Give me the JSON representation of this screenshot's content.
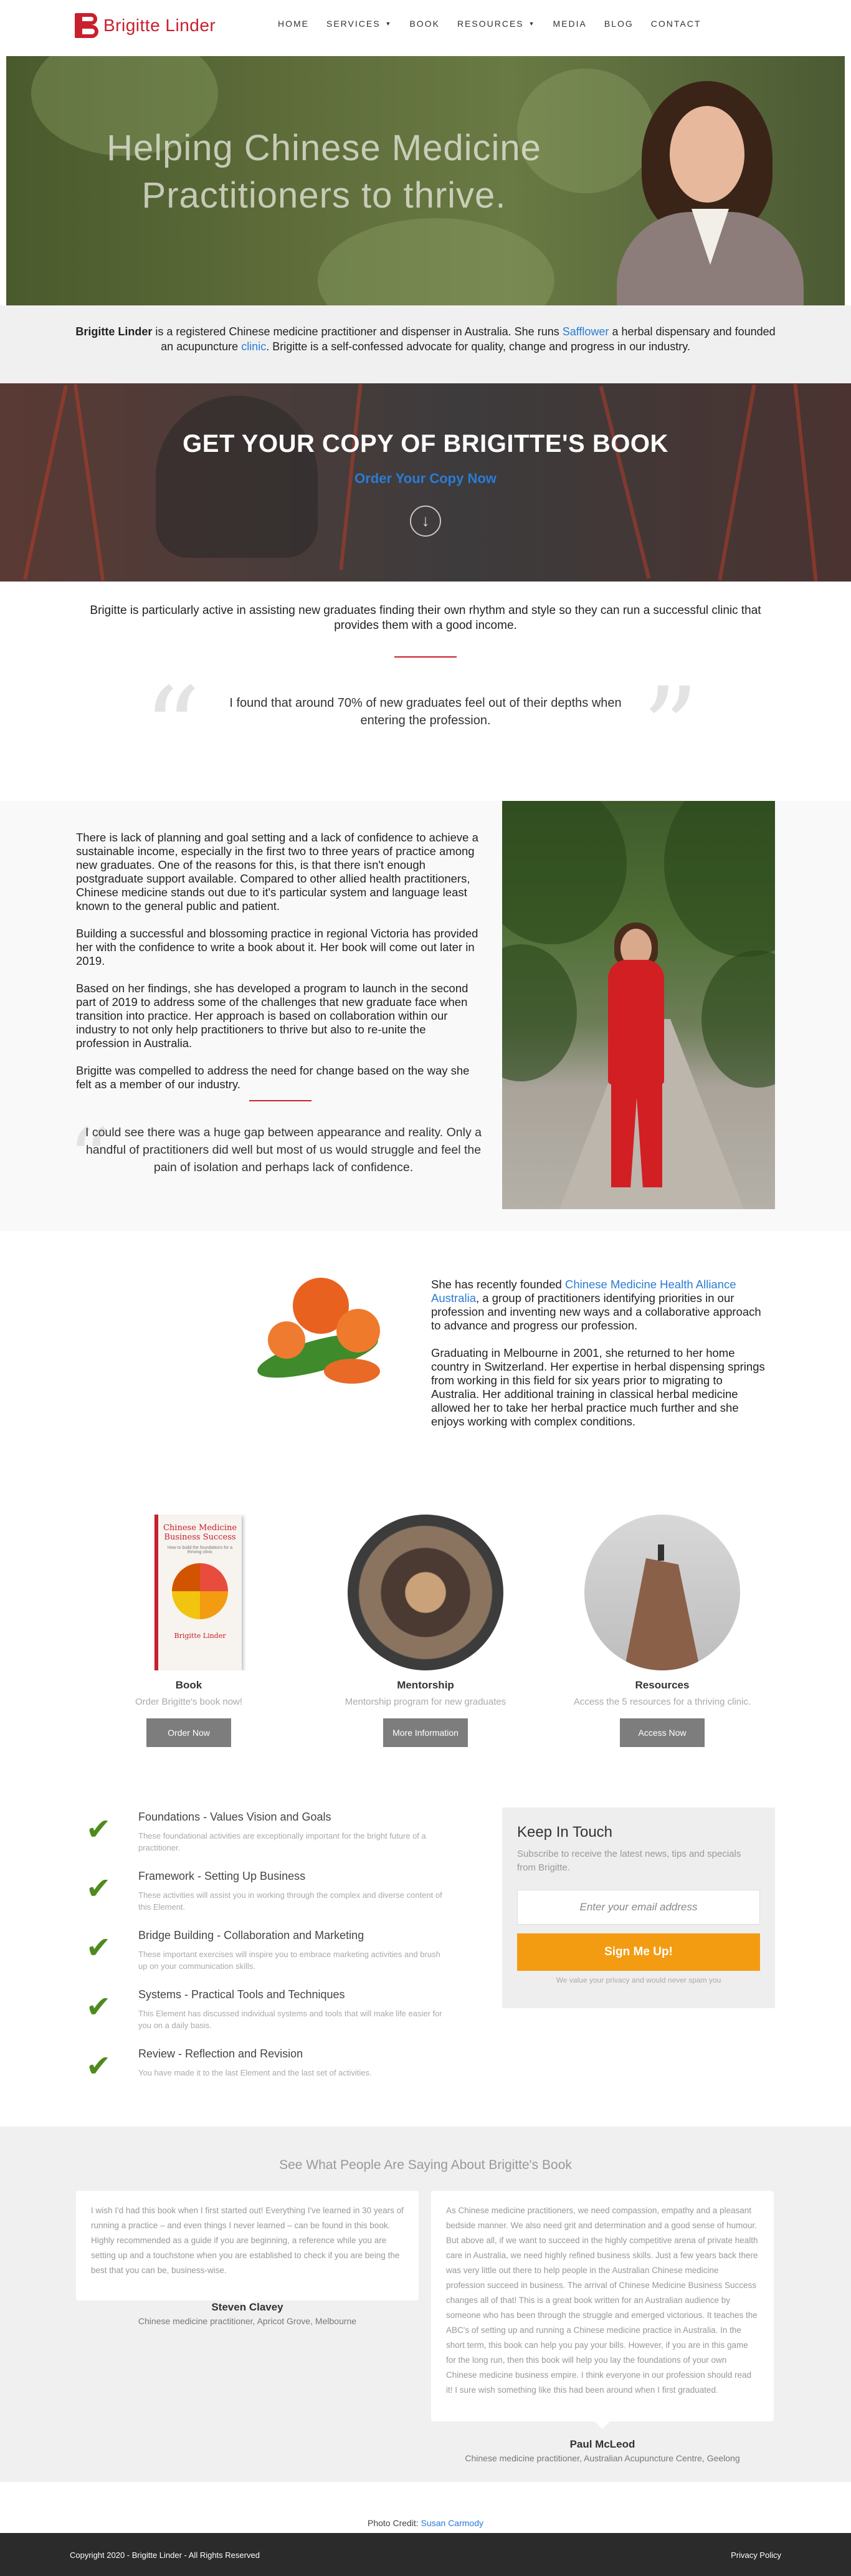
{
  "nav": {
    "logo_text": "Brigitte Linder",
    "items": [
      {
        "label": "HOME",
        "dropdown": false
      },
      {
        "label": "SERVICES",
        "dropdown": true
      },
      {
        "label": "BOOK",
        "dropdown": false
      },
      {
        "label": "RESOURCES",
        "dropdown": true
      },
      {
        "label": "MEDIA",
        "dropdown": false
      },
      {
        "label": "BLOG",
        "dropdown": false
      },
      {
        "label": "CONTACT",
        "dropdown": false
      }
    ]
  },
  "hero": {
    "title": "Helping Chinese Medicine Practitioners to thrive."
  },
  "intro": {
    "name": "Brigitte Linder",
    "text1": " is a registered Chinese medicine practitioner and dispenser in Australia. She runs ",
    "link1": "Safflower",
    "text2": " a herbal dispensary and founded an acupuncture ",
    "link2": "clinic",
    "text3": ". Brigitte is a self-confessed advocate for quality, change and progress in our industry."
  },
  "book_banner": {
    "title": "GET YOUR COPY OF BRIGITTE'S BOOK",
    "link": "Order Your Copy Now",
    "down_icon": "arrow-down-circle-icon"
  },
  "active_text": "Brigitte is particularly active in assisting new graduates finding their own rhythm and style so they can run a successful clinic that provides them with a good income.",
  "quote1": "I found that around 70% of new graduates feel out of their depths when entering the profession.",
  "story": {
    "paragraphs": [
      "There is lack of planning and goal setting and a lack of confidence to achieve a sustainable income, especially in the first two to three years of practice among new graduates. One of the reasons for this, is that there isn't enough postgraduate support available. Compared to other allied health practitioners, Chinese medicine stands out due to it's particular system and language least known to the general public and patient.",
      "Building a successful and blossoming practice in regional Victoria has provided her with the confidence to write a book about it. Her book will come out later in 2019.",
      "Based on her findings, she has developed a program to launch in the second part of 2019 to address some of the challenges that new graduate face when transition into practice. Her approach is based on collaboration within our industry to not only help practitioners to thrive but also to re-unite the profession in Australia.",
      "Brigitte was compelled to address the need for change based on the way she felt as a member of our industry."
    ],
    "quote": "I could see there was a huge gap between appearance and reality. Only a handful of practitioners did well but most of us would struggle and feel the pain of isolation and perhaps lack of confidence."
  },
  "founded": {
    "p1_before": "She has recently founded ",
    "p1_link": "Chinese Medicine Health Alliance Australia",
    "p1_after": ", a group of practitioners identifying priorities in our profession and inventing new ways and a collaborative approach to advance and progress our profession.",
    "p2": "Graduating in Melbourne in 2001, she returned to her home country in Switzerland. Her expertise in herbal dispensing springs from working in this field for six years prior to migrating to Australia. Her additional training in classical herbal medicine allowed her to take her herbal practice much further and she enjoys working with complex conditions."
  },
  "cards": [
    {
      "title": "Book",
      "sub": "Order Brigitte's book now!",
      "button": "Order Now",
      "book_title": "Chinese Medicine Business Success",
      "book_sub": "How to build the foundations for a thriving clinic",
      "book_author": "Brigitte Linder"
    },
    {
      "title": "Mentorship",
      "sub": "Mentorship program for new graduates",
      "button": "More Information"
    },
    {
      "title": "Resources",
      "sub": "Access the 5 resources for a thriving clinic.",
      "button": "Access Now"
    }
  ],
  "steps": [
    {
      "title": "Foundations - Values Vision and Goals",
      "desc": "These foundational activities are exceptionally important for the bright future of a practitioner.",
      "icon": "checkmark-icon"
    },
    {
      "title": "Framework - Setting Up Business",
      "desc": "These activities will assist you in working through the complex and diverse content of this Element.",
      "icon": "checkmark-icon"
    },
    {
      "title": "Bridge Building - Collaboration and Marketing",
      "desc": "These important exercises will inspire you to embrace marketing activities and brush up on your communication skills.",
      "icon": "checkmark-icon"
    },
    {
      "title": "Systems - Practical Tools and Techniques",
      "desc": "This Element has discussed individual systems and tools that will make life easier for you on a daily basis.",
      "icon": "checkmark-icon"
    },
    {
      "title": "Review - Reflection and Revision",
      "desc": "You have made it to the last Element and the last set of activities.",
      "icon": "checkmark-icon"
    }
  ],
  "keep_in_touch": {
    "title": "Keep In Touch",
    "lead": "Subscribe to receive the latest news, tips and specials from Brigitte.",
    "email_placeholder": "Enter your email address",
    "button": "Sign Me Up!",
    "privacy": "We value your privacy and would never spam you"
  },
  "testimonials": {
    "heading": "See What People Are Saying About Brigitte's Book",
    "items": [
      {
        "text": "I wish I'd had this book when I first started out! Everything I've learned in 30 years of running a practice – and even things I never learned – can be found in this book. Highly recommended as a guide if you are beginning, a reference while you are setting up and a touchstone when you are established to check if you are being the best that you can be, business-wise.",
        "name": "Steven Clavey",
        "role": "Chinese medicine practitioner, Apricot Grove, Melbourne"
      },
      {
        "text": "As Chinese medicine practitioners, we need compassion, empathy and a pleasant bedside manner. We also need grit and determination and a good sense of humour. But above all, if we want to succeed in the highly competitive arena of private health care in Australia, we need highly refined business skills. Just a few years back there was very little out there to help people in the Australian Chinese medicine profession succeed in business. The arrival of Chinese Medicine Business Success changes all of that! This is a great book written for an Australian audience by someone who has been through the struggle and emerged victorious. It teaches the ABC's of setting up and running a Chinese medicine practice in Australia. In the short term, this book can help you pay your bills. However, if you are in this game for the long run, then this book will help you lay the foundations of your own Chinese medicine business empire. I think everyone in our profession should read it! I sure wish something like this had been around when I first graduated.",
        "name": "Paul McLeod",
        "role": "Chinese medicine practitioner, Australian Acupuncture Centre, Geelong"
      }
    ]
  },
  "credit": {
    "label": "Photo Credit: ",
    "name": "Susan Carmody"
  },
  "footer": {
    "copyright": "Copyright 2020 - Brigitte Linder - All Rights Reserved",
    "privacy": "Privacy Policy"
  },
  "colors": {
    "brand_red": "#c8202e",
    "link_blue": "#2b7bd6",
    "signup_orange": "#f39c12",
    "check_green": "#4f8a1e"
  }
}
